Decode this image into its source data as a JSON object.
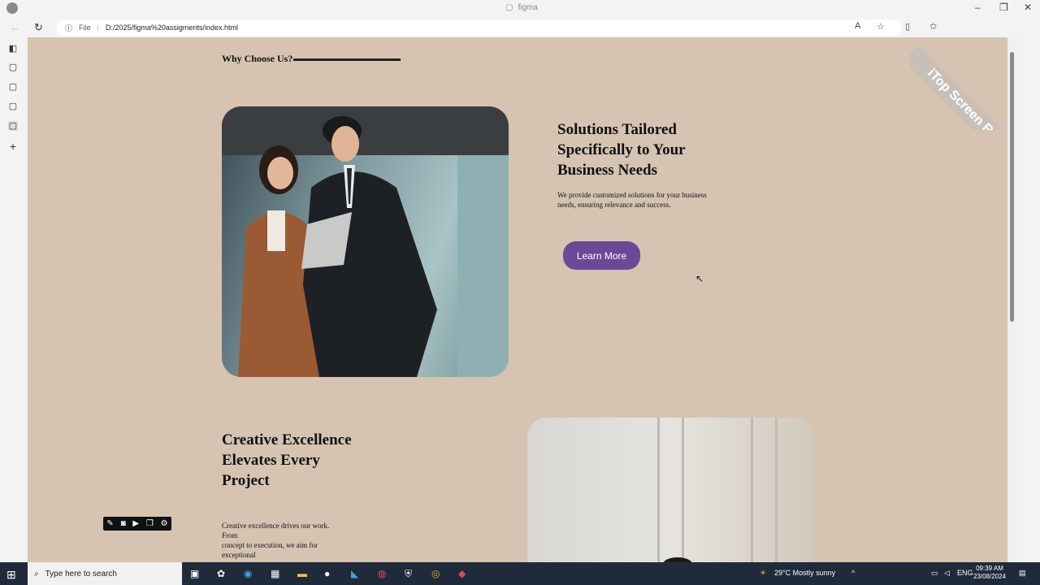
{
  "browser": {
    "tab_title": "figma",
    "address_scheme": "File",
    "address_url": "D:/2025/figma%20assigments/index.html"
  },
  "page": {
    "section_label": "Why Choose Us?",
    "block1": {
      "heading": "Solutions Tailored Specifically to Your Business Needs",
      "body": "We provide customized solutions for your business needs, ensuring relevance and success.",
      "button_label": "Learn More"
    },
    "block2": {
      "heading": "Creative Excellence Elevates Every Project",
      "body_line1": "Creative excellence drives our work.",
      "body_line2": "From",
      "body_line3": "concept to execution, we aim for",
      "body_line4": "exceptional"
    },
    "accent_color": "#6a4a96",
    "background_color": "#d6c3b2"
  },
  "watermark": "iTop Screen Recorder",
  "taskbar": {
    "search_placeholder": "Type here to search",
    "weather": "29°C  Mostly sunny",
    "language": "ENG",
    "time": "09:39 AM",
    "date": "23/08/2024"
  }
}
